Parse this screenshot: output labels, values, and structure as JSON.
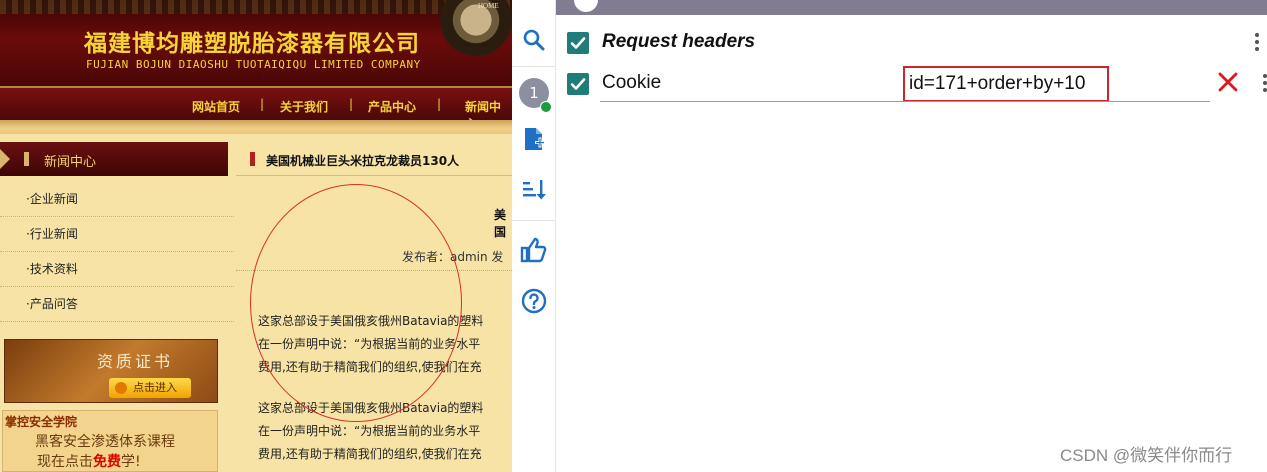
{
  "site": {
    "company_cn": "福建博均雕塑脱胎漆器有限公司",
    "company_en": "FUJIAN BOJUN DIAOSHU  TUOTAIQIQU  LIMITED COMPANY",
    "ornament_text": "HOME",
    "nav": [
      "网站首页",
      "关于我们",
      "产品中心",
      "新闻中心"
    ],
    "nav_separator": "|",
    "sidebar_title": "新闻中心",
    "sidebar_items": [
      "·企业新闻",
      "·行业新闻",
      "·技术资料",
      "·产品问答"
    ],
    "cert_title": "资质证书",
    "cert_button": "点击进入",
    "ad_line1": "掌控安全学院",
    "ad_line2": "黑客安全渗透体系课程",
    "ad_line3_pre": "现在点击",
    "ad_line3_free": "免费",
    "ad_line3_post": "学!",
    "article_title": "美国机械业巨头米拉克龙裁员130人",
    "article_subtitle": "美国",
    "article_meta": "发布者：admin 发",
    "paragraphs": [
      [
        "这家总部设于美国俄亥俄州Batavia的塑料",
        "在一份声明中说：“为根据当前的业务水平",
        "费用,还有助于精简我们的组织,使我们在充"
      ],
      [
        "这家总部设于美国俄亥俄州Batavia的塑料",
        "在一份声明中说：“为根据当前的业务水平",
        "费用,还有助于精简我们的组织,使我们在充"
      ]
    ]
  },
  "toolbar": {
    "icons": [
      "search-icon",
      "profile-badge",
      "add-file-icon",
      "sort-icon",
      "thumbs-up-icon",
      "help-icon"
    ],
    "badge_number": "1",
    "accent": "#1f6fc5"
  },
  "panel": {
    "section_label": "Request headers",
    "header_name": "Cookie",
    "header_value": "id=171+order+by+10",
    "checked_color": "#1f7c78",
    "highlight_color": "#c9272b"
  },
  "watermark": "CSDN @微笑伴你而行"
}
